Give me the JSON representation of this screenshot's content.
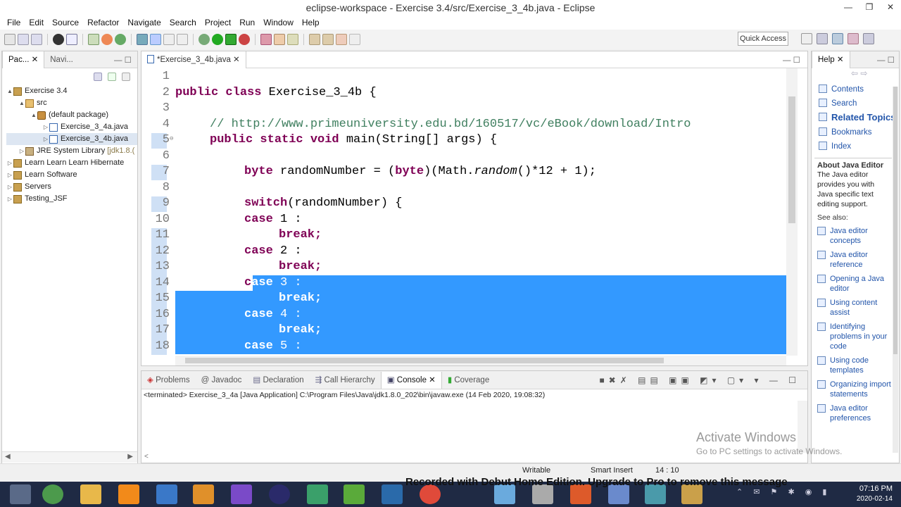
{
  "window": {
    "title": "eclipse-workspace - Exercise 3.4/src/Exercise_3_4b.java - Eclipse",
    "controls": [
      "—",
      "❐",
      "✕"
    ]
  },
  "menu": [
    "File",
    "Edit",
    "Source",
    "Refactor",
    "Navigate",
    "Search",
    "Project",
    "Run",
    "Window",
    "Help"
  ],
  "toolbar": {
    "quick_access": "Quick Access"
  },
  "explorer": {
    "tabs": [
      {
        "label": "Pac..."
      },
      {
        "label": "Navi..."
      }
    ],
    "tree": [
      {
        "label": "Exercise 3.4",
        "indent": 0,
        "twisty": "▲",
        "icon": "project-icon"
      },
      {
        "label": "src",
        "indent": 1,
        "twisty": "▲",
        "icon": "source-folder-icon"
      },
      {
        "label": "(default package)",
        "indent": 2,
        "twisty": "▲",
        "icon": "package-icon"
      },
      {
        "label": "Exercise_3_4a.java",
        "indent": 3,
        "twisty": "▷",
        "icon": "java-file-icon"
      },
      {
        "label": "Exercise_3_4b.java",
        "indent": 3,
        "twisty": "▷",
        "icon": "java-file-icon"
      },
      {
        "label": "JRE System Library",
        "suffix": "[jdk1.8.(",
        "indent": 1,
        "twisty": "▷",
        "icon": "library-icon"
      },
      {
        "label": "Learn Learn Learn Hibernate",
        "indent": 0,
        "twisty": "▷",
        "icon": "project-icon"
      },
      {
        "label": "Learn Software",
        "indent": 0,
        "twisty": "▷",
        "icon": "project-icon"
      },
      {
        "label": "Servers",
        "indent": 0,
        "twisty": "▷",
        "icon": "project-icon"
      },
      {
        "label": "Testing_JSF",
        "indent": 0,
        "twisty": "▷",
        "icon": "project-icon"
      }
    ]
  },
  "editor": {
    "tab_label": "*Exercise_3_4b.java",
    "line_numbers": [
      "1",
      "2",
      "3",
      "4",
      "5",
      "6",
      "7",
      "8",
      "9",
      "10",
      "11",
      "12",
      "13",
      "14",
      "15",
      "16",
      "17",
      "18"
    ],
    "lines": {
      "l2_kw": "public class ",
      "l2_rest": "Exercise_3_4b {",
      "l4": "// http://www.primeuniversity.edu.bd/160517/vc/eBook/download/Intro",
      "l5_kw": "public static void ",
      "l5_rest": "main(String[] args) {",
      "l7_kw": "byte ",
      "l7_a": "randomNumber = (",
      "l7_kw2": "byte",
      "l7_b": ")(Math.",
      "l7_it": "random",
      "l7_c": "()*12 + 1);",
      "l9_kw": "switch",
      "l9_rest": "(randomNumber) {",
      "case_kw": "case ",
      "c1": "1 :",
      "c2": "2 :",
      "c3": "3 :",
      "c4": "4 :",
      "c5": "5 :",
      "brk": "break;",
      "l14_c": "c",
      "l14_ase": "ase "
    }
  },
  "help": {
    "tab_label": "Help",
    "nav": [
      {
        "label": "Contents"
      },
      {
        "label": "Search"
      },
      {
        "label": "Related Topics"
      },
      {
        "label": "Bookmarks"
      },
      {
        "label": "Index"
      }
    ],
    "about_title": "About Java Editor",
    "about_text": "The Java editor provides you with Java specific text editing support.",
    "see_also": "See also:",
    "links": [
      "Java editor concepts",
      "Java editor reference",
      "Opening a Java editor",
      "Using content assist",
      "Identifying problems in your code",
      "Using code templates",
      "Organizing import statements",
      "Java editor preferences"
    ]
  },
  "console": {
    "tabs": [
      {
        "label": "Problems"
      },
      {
        "label": "Javadoc"
      },
      {
        "label": "Declaration"
      },
      {
        "label": "Call Hierarchy"
      },
      {
        "label": "Console"
      },
      {
        "label": "Coverage"
      }
    ],
    "terminated": "<terminated> Exercise_3_4a [Java Application] C:\\Program Files\\Java\\jdk1.8.0_202\\bin\\javaw.exe (14 Feb 2020, 19:08:32)"
  },
  "status": {
    "writable": "Writable",
    "insert_mode": "Smart Insert",
    "position": "14 : 10"
  },
  "overlay": {
    "activate_title": "Activate Windows",
    "activate_sub": "Go to PC settings to activate Windows.",
    "recorder": "Recorded with Debut Home Edition. Upgrade to Pro to remove this message"
  },
  "taskbar": {
    "time": "07:16 PM",
    "date": "2020-02-14"
  },
  "colors": {
    "selection": "#3399ff",
    "keyword": "#7f0055",
    "comment": "#3f7f5f",
    "taskbar": "#1f2a44"
  }
}
